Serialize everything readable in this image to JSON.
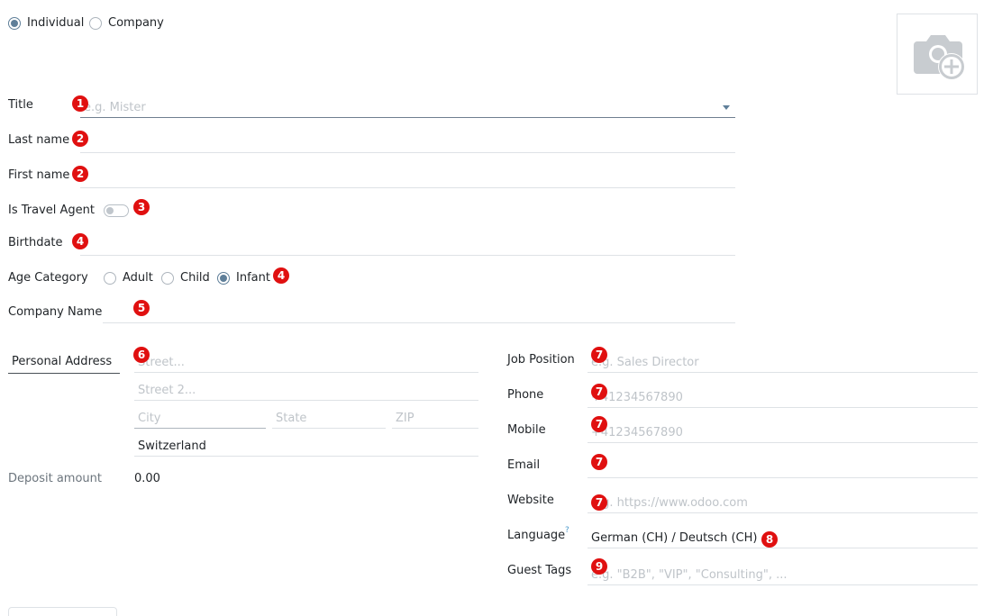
{
  "partner_type": {
    "options": [
      {
        "label": "Individual",
        "selected": true
      },
      {
        "label": "Company",
        "selected": false
      }
    ]
  },
  "form": {
    "title": {
      "label": "Title",
      "placeholder": "e.g. Mister",
      "value": ""
    },
    "last_name": {
      "label": "Last name",
      "value": ""
    },
    "first_name": {
      "label": "First name",
      "value": ""
    },
    "is_travel_agent": {
      "label": "Is Travel Agent",
      "checked": false
    },
    "birthdate": {
      "label": "Birthdate",
      "value": ""
    },
    "age_category": {
      "label": "Age Category",
      "options": [
        {
          "label": "Adult",
          "selected": false
        },
        {
          "label": "Child",
          "selected": false
        },
        {
          "label": "Infant",
          "selected": true
        }
      ]
    },
    "company_name": {
      "label": "Company Name",
      "value": ""
    }
  },
  "address": {
    "tab_label": "Personal Address",
    "street_placeholder": "Street...",
    "street2_placeholder": "Street 2...",
    "city_placeholder": "City",
    "state_placeholder": "State",
    "zip_placeholder": "ZIP",
    "country": "Switzerland"
  },
  "deposit": {
    "label": "Deposit amount",
    "value": "0.00"
  },
  "contact": {
    "job_position": {
      "label": "Job Position",
      "placeholder": "e.g. Sales Director"
    },
    "phone": {
      "label": "Phone",
      "placeholder": "+41234567890"
    },
    "mobile": {
      "label": "Mobile",
      "placeholder": "+41234567890"
    },
    "email": {
      "label": "Email",
      "placeholder": ""
    },
    "website": {
      "label": "Website",
      "placeholder": "e.g. https://www.odoo.com"
    },
    "language": {
      "label": "Language",
      "help": "?",
      "value": "German (CH) / Deutsch (CH)"
    },
    "guest_tags": {
      "label": "Guest Tags",
      "placeholder": "e.g. \"B2B\", \"VIP\", \"Consulting\", ..."
    }
  },
  "badges": {
    "b1": "1",
    "b2a": "2",
    "b2b": "2",
    "b3": "3",
    "b4a": "4",
    "b4b": "4",
    "b5": "5",
    "b6": "6",
    "b7a": "7",
    "b7b": "7",
    "b7c": "7",
    "b7d": "7",
    "b7e": "7",
    "b8": "8",
    "b9": "9"
  },
  "icons": {
    "photo": "camera-plus-icon",
    "dropdown": "caret-down-icon"
  },
  "colors": {
    "badge": "#e01010",
    "radio_selected": "#5f7f99",
    "placeholder": "#bfc4c9",
    "border": "#dee2e6"
  }
}
